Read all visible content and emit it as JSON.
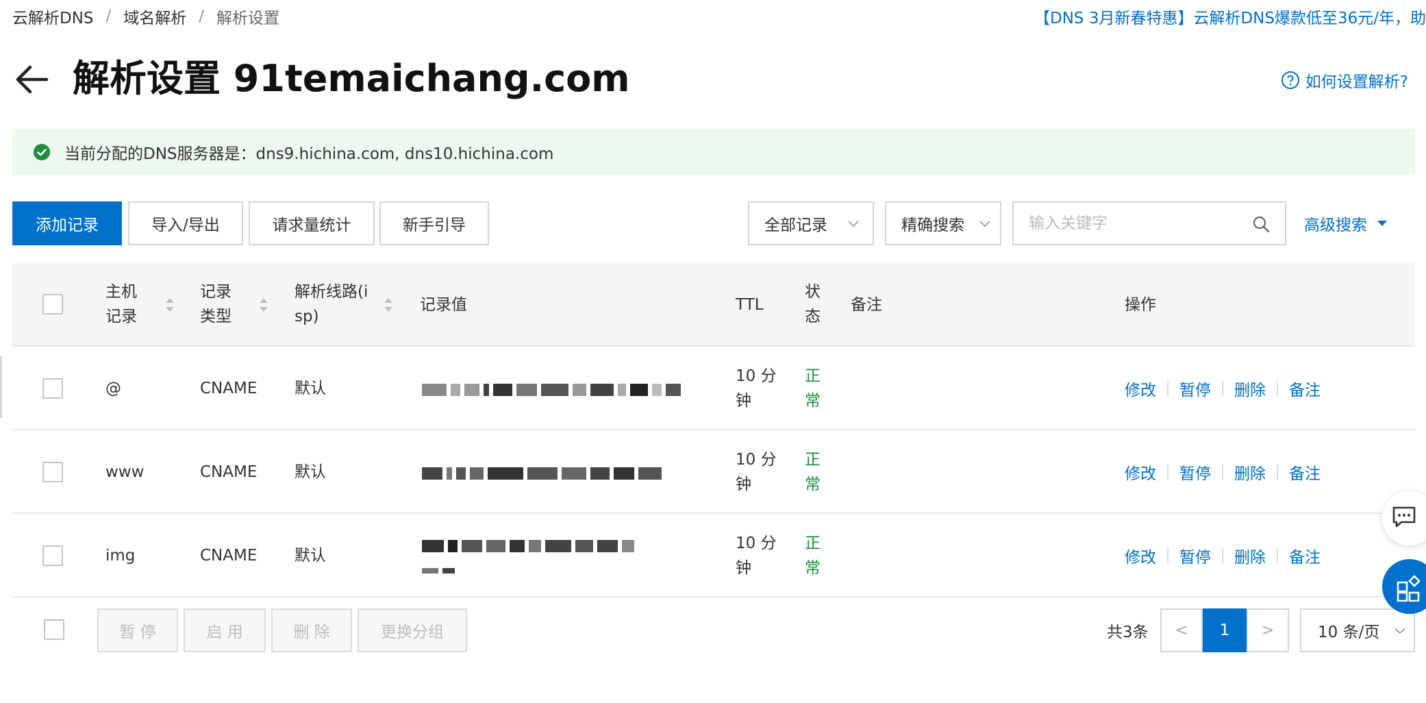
{
  "breadcrumb": {
    "items": [
      "云解析DNS",
      "域名解析"
    ],
    "current": "解析设置",
    "separator": "/"
  },
  "promo": {
    "text": "【DNS 3月新春特惠】云解析DNS爆款低至36元/年，助"
  },
  "header": {
    "title": "解析设置 91temaichang.com",
    "help_label": "如何设置解析?"
  },
  "notice": {
    "text": "当前分配的DNS服务器是：dns9.hichina.com, dns10.hichina.com"
  },
  "toolbar": {
    "add_label": "添加记录",
    "import_export_label": "导入/导出",
    "stats_label": "请求量统计",
    "guide_label": "新手引导",
    "filter_value": "全部记录",
    "search_mode_value": "精确搜索",
    "search_placeholder": "输入关键字",
    "advanced_search_label": "高级搜索"
  },
  "table": {
    "headers": {
      "host_line1": "主机",
      "host_line2": "记录",
      "type_line1": "记录",
      "type_line2": "类型",
      "line_line1": "解析线路(i",
      "line_line2": "sp)",
      "value": "记录值",
      "ttl": "TTL",
      "status_line1": "状",
      "status_line2": "态",
      "remark": "备注",
      "action": "操作"
    },
    "rows": [
      {
        "host": "@",
        "type": "CNAME",
        "line": "默认",
        "ttl_line1": "10 分",
        "ttl_line2": "钟",
        "status_line1": "正",
        "status_line2": "常"
      },
      {
        "host": "www",
        "type": "CNAME",
        "line": "默认",
        "ttl_line1": "10 分",
        "ttl_line2": "钟",
        "status_line1": "正",
        "status_line2": "常"
      },
      {
        "host": "img",
        "type": "CNAME",
        "line": "默认",
        "ttl_line1": "10 分",
        "ttl_line2": "钟",
        "status_line1": "正",
        "status_line2": "常"
      }
    ],
    "actions": {
      "edit": "修改",
      "pause": "暂停",
      "delete": "删除",
      "remark": "备注"
    }
  },
  "footer": {
    "pause_label": "暂 停",
    "enable_label": "启 用",
    "delete_label": "删 除",
    "change_group_label": "更换分组",
    "total_text": "共3条",
    "prev": "<",
    "current_page": "1",
    "next": ">",
    "page_size": "10 条/页"
  },
  "colors": {
    "accent": "#0070cc",
    "success": "#1e8e3e",
    "notice_bg": "#edf9ee"
  },
  "icons": [
    "back-arrow-icon",
    "help-circle-icon",
    "check-circle-icon",
    "chevron-down-icon",
    "search-icon",
    "caret-down-icon",
    "sort-icon",
    "chat-icon",
    "apps-icon"
  ]
}
